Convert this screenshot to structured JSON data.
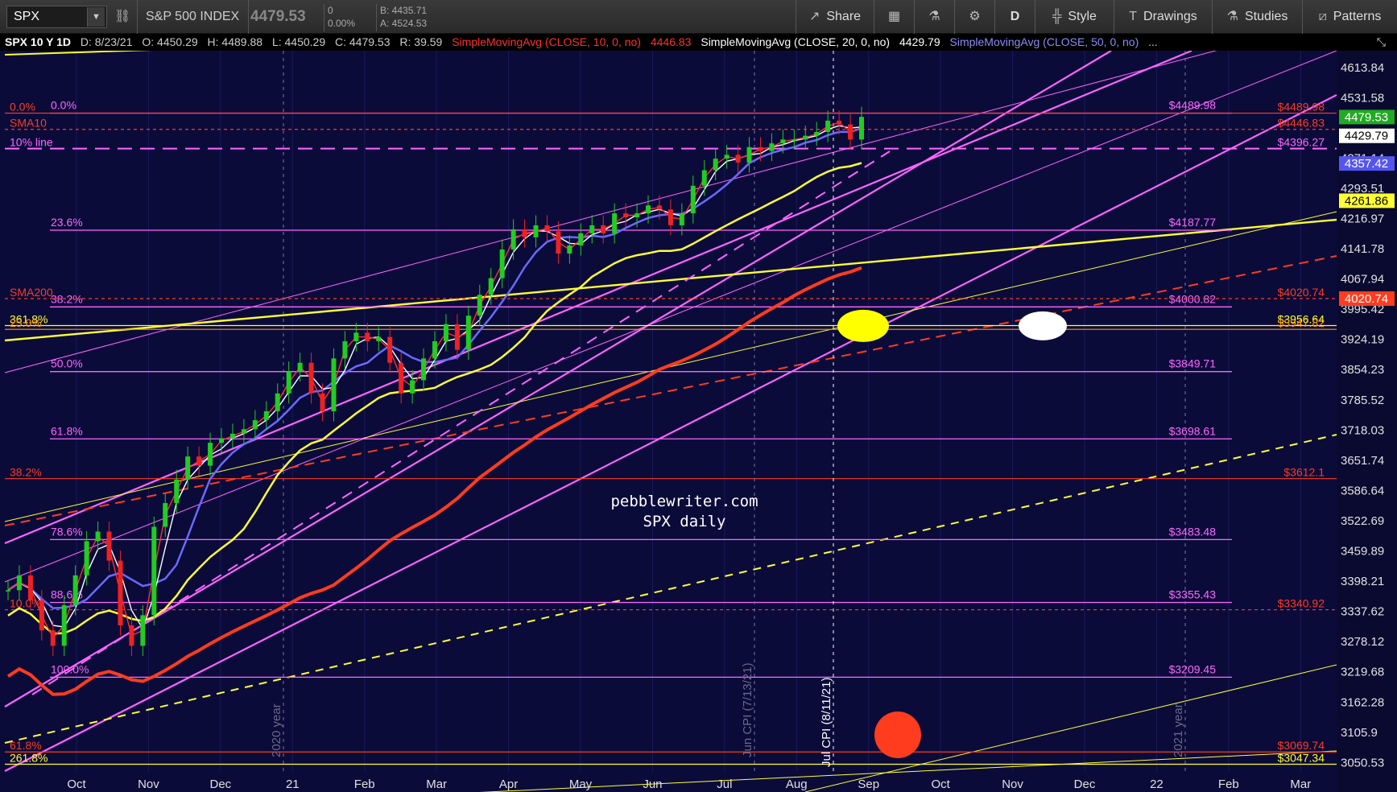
{
  "toolbar": {
    "symbol": "SPX",
    "index_name": "S&P 500 INDEX",
    "last": "4479.53",
    "change": "0",
    "change_pct": "0.00%",
    "bid": "B: 4435.71",
    "ask": "A: 4524.53",
    "share_label": "Share",
    "period_label": "D",
    "style_label": "Style",
    "drawings_label": "Drawings",
    "studies_label": "Studies",
    "patterns_label": "Patterns"
  },
  "infobar": {
    "title": "SPX 10 Y 1D",
    "date": "D: 8/23/21",
    "open": "O: 4450.29",
    "high": "H: 4489.88",
    "low": "L: 4450.29",
    "close": "C: 4479.53",
    "range": "R: 39.59",
    "sma10_label": "SimpleMovingAvg (CLOSE, 10, 0, no)",
    "sma10_value": "4446.83",
    "sma20_label": "SimpleMovingAvg (CLOSE, 20, 0, no)",
    "sma20_value": "4429.79",
    "sma50_label": "SimpleMovingAvg (CLOSE, 50, 0, no)",
    "more": "..."
  },
  "colors": {
    "background": "#0b0b3a",
    "sma10": "#ff3030",
    "sma20": "#ffffff",
    "sma50": "#6a6aff",
    "sma100": "#ffff33",
    "sma200": "#ff3c1e",
    "fib": "#ff66ff",
    "trend": "#ffff33"
  },
  "watermark": {
    "line1": "pebblewriter.com",
    "line2": "SPX daily"
  },
  "chart_data": {
    "type": "line",
    "title": "SPX 10 Y 1D",
    "x_ticks": [
      "Oct",
      "Nov",
      "Dec",
      "21",
      "Feb",
      "Mar",
      "Apr",
      "May",
      "Jun",
      "Jul",
      "Aug",
      "Sep",
      "Oct",
      "Nov",
      "Dec",
      "22",
      "Feb",
      "Mar"
    ],
    "y_ticks": [
      "4613.84",
      "4531.58",
      "4371.14",
      "4293.51",
      "4216.97",
      "4141.78",
      "4067.94",
      "3995.42",
      "3924.19",
      "3854.23",
      "3785.52",
      "3718.03",
      "3651.74",
      "3586.64",
      "3522.69",
      "3459.89",
      "3398.21",
      "3337.62",
      "3278.12",
      "3219.68",
      "3162.28",
      "3105.9",
      "3050.53"
    ],
    "ylim": [
      3035,
      4660
    ],
    "log_scale": true,
    "price_tags": [
      {
        "text": "4479.53",
        "value": 4479.53,
        "bg": "#22aa22",
        "fg": "#ffffff"
      },
      {
        "text": "4429.79",
        "value": 4429.79,
        "bg": "#ffffff",
        "fg": "#000000"
      },
      {
        "text": "4357.42",
        "value": 4357.42,
        "bg": "#5555ee",
        "fg": "#ffffff"
      },
      {
        "text": "4261.86",
        "value": 4261.86,
        "bg": "#ffff33",
        "fg": "#000000"
      },
      {
        "text": "4020.74",
        "value": 4020.74,
        "bg": "#ff3c1e",
        "fg": "#ffffff"
      }
    ],
    "fib_levels": [
      {
        "pct": "0.0%",
        "value": 4489.98,
        "label": "$4489.98"
      },
      {
        "pct": "23.6%",
        "value": 4187.77,
        "label": "$4187.77"
      },
      {
        "pct": "38.2%",
        "value": 4000.82,
        "label": "$4000.82"
      },
      {
        "pct": "50.0%",
        "value": 3849.71,
        "label": "$3849.71"
      },
      {
        "pct": "61.8%",
        "value": 3698.61,
        "label": "$3698.61"
      },
      {
        "pct": "78.6%",
        "value": 3483.48,
        "label": "$3483.48"
      },
      {
        "pct": "88.6%",
        "value": 3355.43,
        "label": "$3355.43"
      },
      {
        "pct": "100.0%",
        "value": 3209.45,
        "label": "$3209.45"
      }
    ],
    "red_levels": [
      {
        "pct": "0.0%",
        "value": 4489.98,
        "label": "$4489.98"
      },
      {
        "pct": "SMA10",
        "value": 4446.83,
        "label": "$4446.83"
      },
      {
        "pct": "SMA200",
        "value": 4020.74,
        "label": "$4020.74"
      },
      {
        "pct": "38.2%",
        "value": 3612.1,
        "label": "$3612.1"
      },
      {
        "pct": "10.0%",
        "value": 3340.92,
        "label": "$3340.92"
      },
      {
        "pct": "61.8%",
        "value": 3069.74,
        "label": "$3069.74"
      }
    ],
    "other_levels": [
      {
        "text": "10% line",
        "value": 4396.27,
        "label": "$4396.27"
      },
      {
        "text": "361.8%",
        "value": 3956.64,
        "label": "$3956.64"
      },
      {
        "text": "261.8%",
        "value": 3047.34,
        "label": "$3047.34"
      },
      {
        "text": "25.0%",
        "value": 3947.82,
        "label": "$3947.82"
      }
    ],
    "event_lines": [
      {
        "label": "2020 year",
        "x": "Jan 1 2021"
      },
      {
        "label": "Jun CPI (7/13/21)",
        "x": "Jul 13 2021"
      },
      {
        "label": "Jul CPI (8/11/21)",
        "x": "Aug 11 2021"
      },
      {
        "label": "2021 year",
        "x": "Jan 1 2022"
      }
    ],
    "series": [
      {
        "name": "SPX",
        "values": [
          3380,
          3410,
          3360,
          3300,
          3270,
          3350,
          3410,
          3480,
          3500,
          3440,
          3310,
          3270,
          3330,
          3510,
          3560,
          3610,
          3660,
          3640,
          3690,
          3700,
          3710,
          3720,
          3740,
          3760,
          3800,
          3850,
          3870,
          3800,
          3760,
          3880,
          3920,
          3940,
          3920,
          3930,
          3870,
          3800,
          3830,
          3880,
          3920,
          3960,
          3900,
          3980,
          4030,
          4070,
          4140,
          4190,
          4170,
          4200,
          4185,
          4130,
          4150,
          4180,
          4200,
          4180,
          4230,
          4220,
          4230,
          4250,
          4240,
          4200,
          4230,
          4300,
          4340,
          4370,
          4380,
          4360,
          4400,
          4390,
          4410,
          4420,
          4420,
          4430,
          4440,
          4470,
          4460,
          4420,
          4480
        ]
      }
    ]
  }
}
